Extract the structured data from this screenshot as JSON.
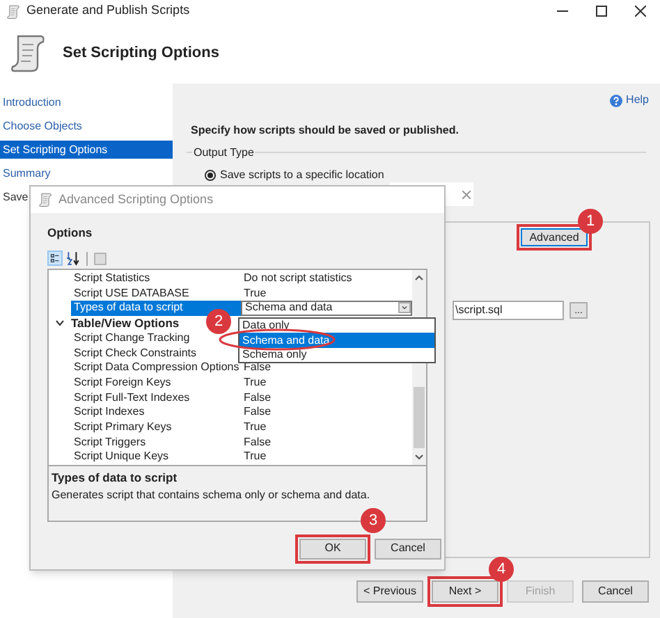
{
  "window": {
    "title": "Generate and Publish Scripts"
  },
  "header": {
    "title": "Set Scripting Options"
  },
  "sidebar": {
    "items": [
      {
        "label": "Introduction",
        "selected": false
      },
      {
        "label": "Choose Objects",
        "selected": false
      },
      {
        "label": "Set Scripting Options",
        "selected": true
      },
      {
        "label": "Summary",
        "selected": false
      },
      {
        "label": "Save",
        "selected": false
      }
    ]
  },
  "help": "Help",
  "instruction": "Specify how scripts should be saved or published.",
  "output_type": {
    "label": "Output Type",
    "option": "Save scripts to a specific location",
    "selected": true
  },
  "advanced_button": "Advanced",
  "file_field": {
    "value": "\\script.sql",
    "browse": "..."
  },
  "footer_buttons": [
    {
      "label": "< Previous",
      "disabled": false
    },
    {
      "label": "Next >",
      "disabled": false
    },
    {
      "label": "Finish",
      "disabled": true
    },
    {
      "label": "Cancel",
      "disabled": false
    }
  ],
  "dialog": {
    "title": "Advanced Scripting Options",
    "section": "Options",
    "rows": [
      {
        "kind": "property",
        "name": "Script Statistics",
        "value": "Do not script statistics",
        "selected": false
      },
      {
        "kind": "property",
        "name": "Script USE DATABASE",
        "value": "True",
        "selected": false
      },
      {
        "kind": "property",
        "name": "Types of data to script",
        "value": "Schema and data",
        "selected": true
      },
      {
        "kind": "category",
        "name": "Table/View Options",
        "expanded": true
      },
      {
        "kind": "property",
        "name": "Script Change Tracking",
        "selected": false
      },
      {
        "kind": "property",
        "name": "Script Check Constraints",
        "selected": false
      },
      {
        "kind": "property",
        "name": "Script Data Compression Options",
        "value": "False",
        "selected": false
      },
      {
        "kind": "property",
        "name": "Script Foreign Keys",
        "value": "True",
        "selected": false
      },
      {
        "kind": "property",
        "name": "Script Full-Text Indexes",
        "value": "False",
        "selected": false
      },
      {
        "kind": "property",
        "name": "Script Indexes",
        "value": "False",
        "selected": false
      },
      {
        "kind": "property",
        "name": "Script Primary Keys",
        "value": "True",
        "selected": false
      },
      {
        "kind": "property",
        "name": "Script Triggers",
        "value": "False",
        "selected": false
      },
      {
        "kind": "property",
        "name": "Script Unique Keys",
        "value": "True",
        "selected": false
      }
    ],
    "dropdown_options": [
      {
        "label": "Data only",
        "selected": false
      },
      {
        "label": "Schema and data",
        "selected": true
      },
      {
        "label": "Schema only",
        "selected": false
      }
    ],
    "description": {
      "title": "Types of data to script",
      "text": "Generates script that contains schema only or schema and data."
    },
    "buttons": [
      "OK",
      "Cancel"
    ]
  },
  "step_badges": [
    "1",
    "2",
    "3",
    "4"
  ]
}
